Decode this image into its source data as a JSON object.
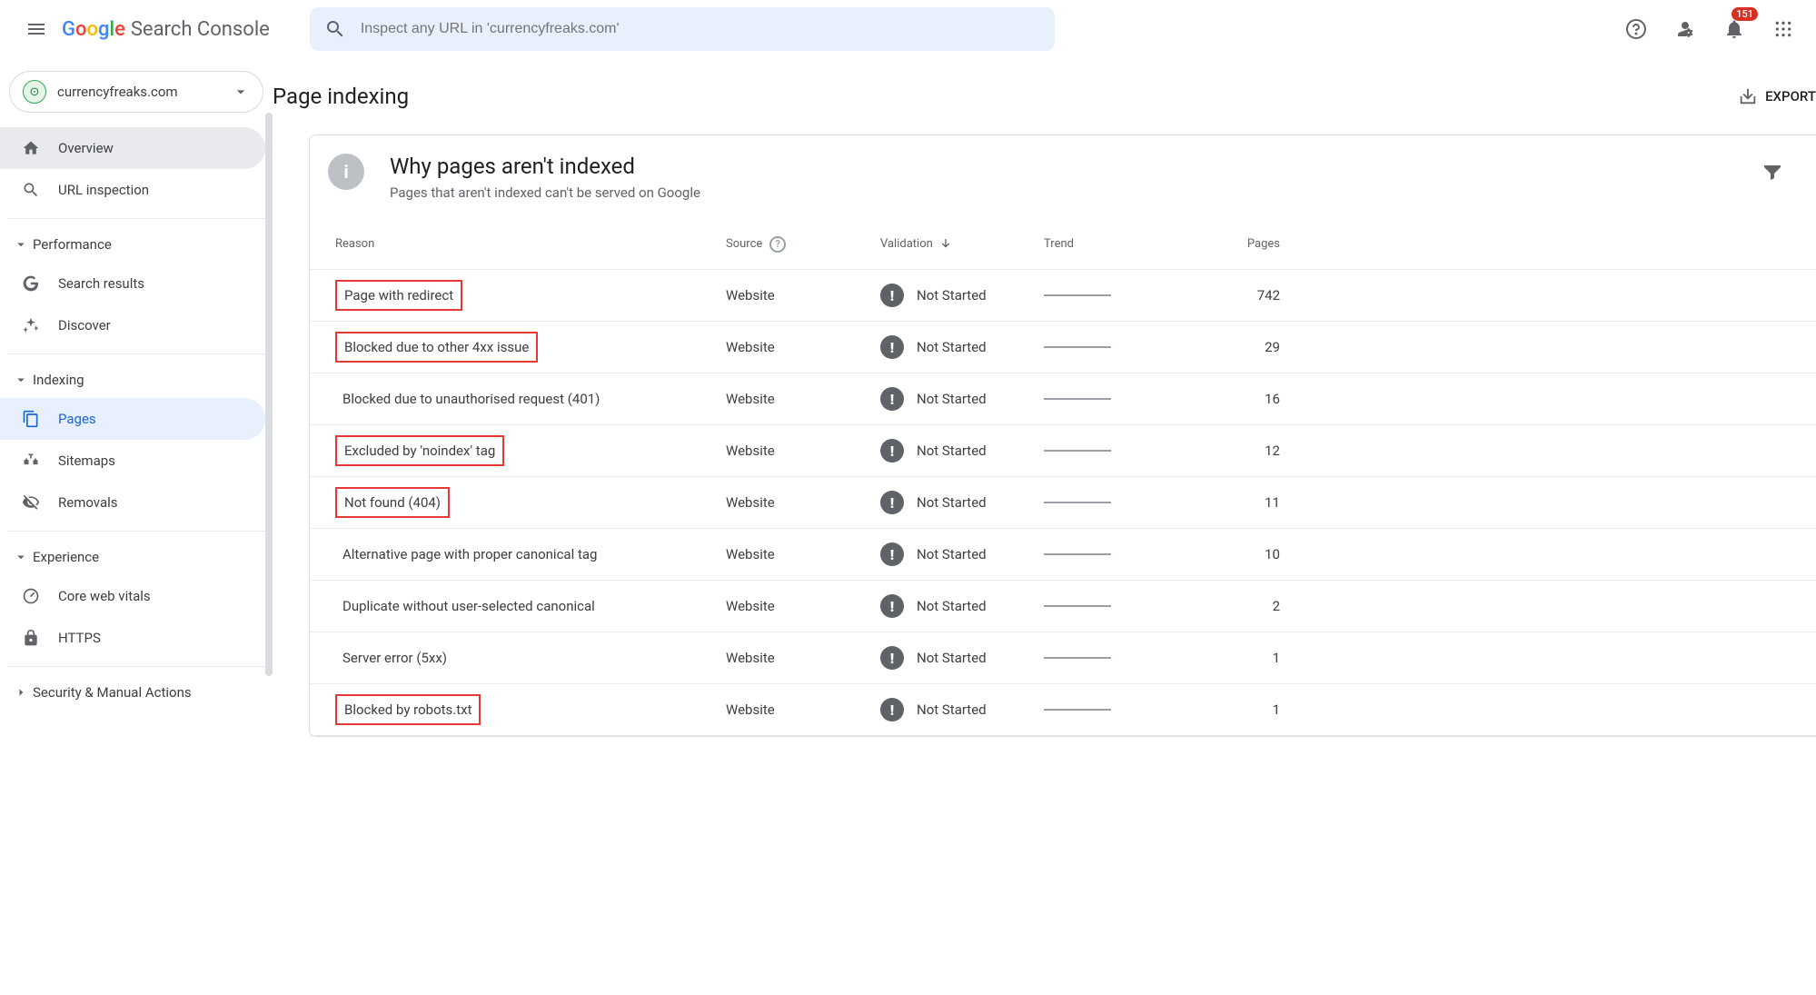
{
  "header": {
    "product": "Search Console",
    "search_placeholder": "Inspect any URL in 'currencyfreaks.com'",
    "notification_count": "151"
  },
  "property": {
    "name": "currencyfreaks.com"
  },
  "sidebar": {
    "overview": "Overview",
    "url_inspection": "URL inspection",
    "performance_group": "Performance",
    "search_results": "Search results",
    "discover": "Discover",
    "indexing_group": "Indexing",
    "pages": "Pages",
    "sitemaps": "Sitemaps",
    "removals": "Removals",
    "experience_group": "Experience",
    "core_web_vitals": "Core web vitals",
    "https": "HTTPS",
    "security_group": "Security & Manual Actions"
  },
  "page": {
    "title": "Page indexing",
    "export": "EXPORT"
  },
  "card": {
    "title": "Why pages aren't indexed",
    "subtitle": "Pages that aren't indexed can't be served on Google"
  },
  "columns": {
    "reason": "Reason",
    "source": "Source",
    "validation": "Validation",
    "trend": "Trend",
    "pages": "Pages"
  },
  "rows": [
    {
      "reason": "Page with redirect",
      "source": "Website",
      "validation": "Not Started",
      "pages": "742",
      "highlight": true
    },
    {
      "reason": "Blocked due to other 4xx issue",
      "source": "Website",
      "validation": "Not Started",
      "pages": "29",
      "highlight": true
    },
    {
      "reason": "Blocked due to unauthorised request (401)",
      "source": "Website",
      "validation": "Not Started",
      "pages": "16",
      "highlight": false
    },
    {
      "reason": "Excluded by 'noindex' tag",
      "source": "Website",
      "validation": "Not Started",
      "pages": "12",
      "highlight": true
    },
    {
      "reason": "Not found (404)",
      "source": "Website",
      "validation": "Not Started",
      "pages": "11",
      "highlight": true
    },
    {
      "reason": "Alternative page with proper canonical tag",
      "source": "Website",
      "validation": "Not Started",
      "pages": "10",
      "highlight": false
    },
    {
      "reason": "Duplicate without user-selected canonical",
      "source": "Website",
      "validation": "Not Started",
      "pages": "2",
      "highlight": false
    },
    {
      "reason": "Server error (5xx)",
      "source": "Website",
      "validation": "Not Started",
      "pages": "1",
      "highlight": false
    },
    {
      "reason": "Blocked by robots.txt",
      "source": "Website",
      "validation": "Not Started",
      "pages": "1",
      "highlight": true
    }
  ]
}
